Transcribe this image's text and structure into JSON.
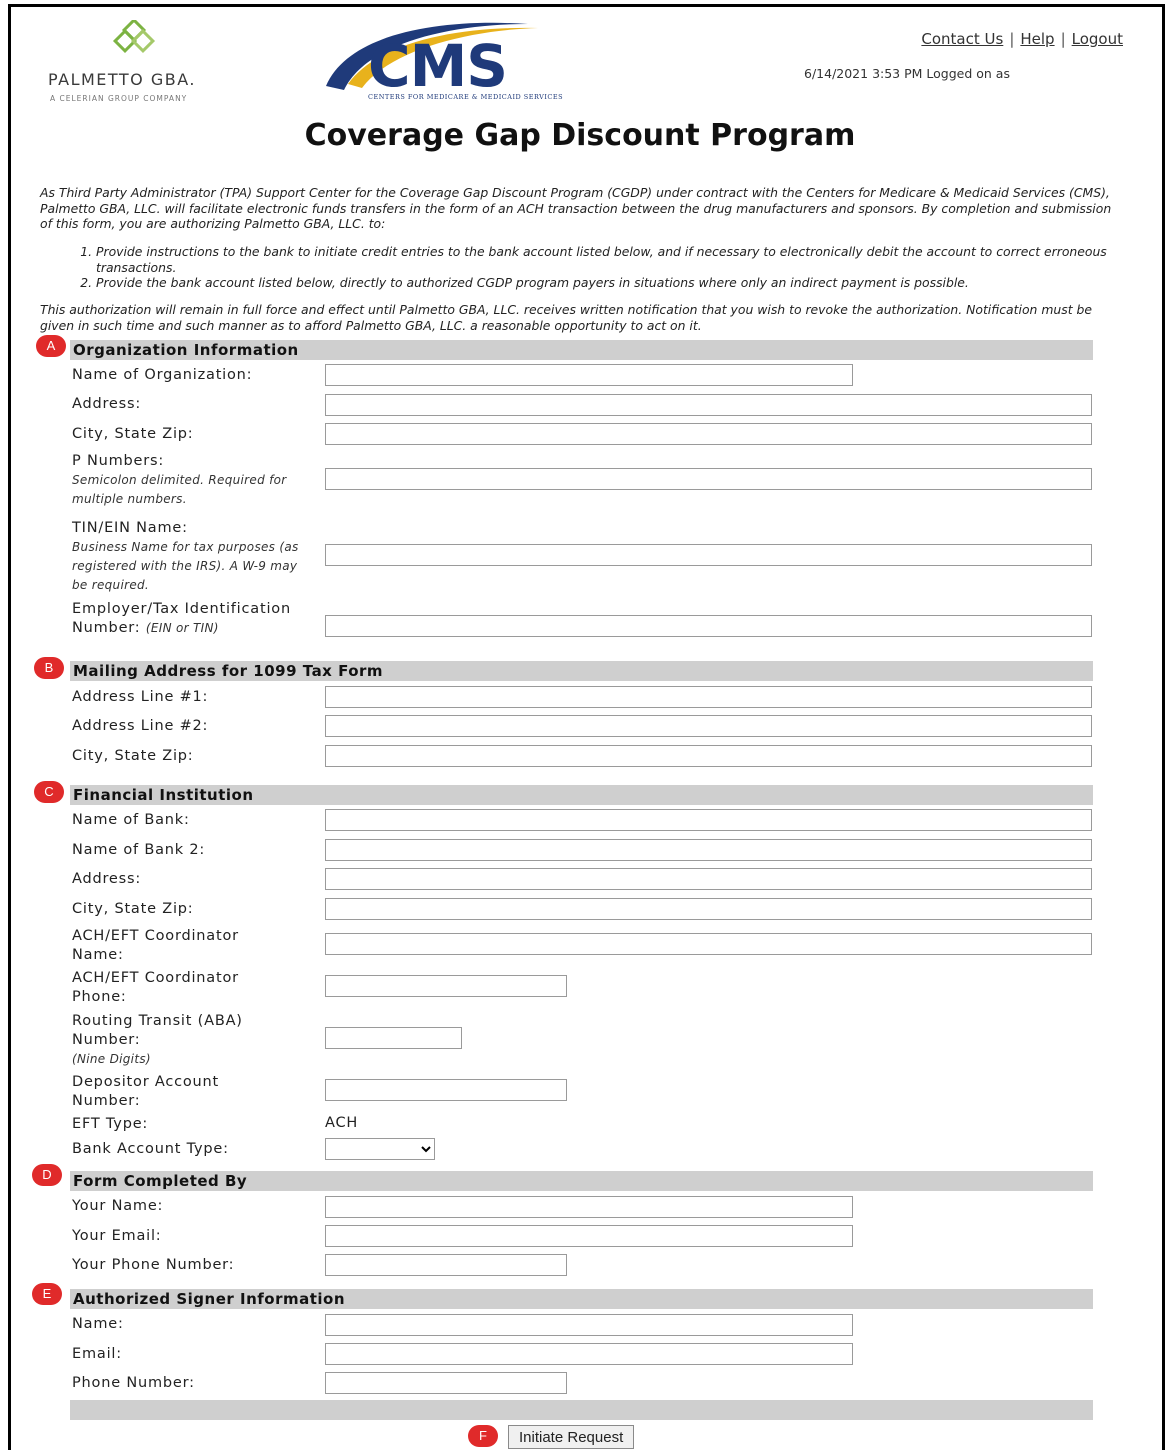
{
  "header": {
    "org_logo_name": "PALMETTO GBA.",
    "org_logo_sub": "A CELERIAN GROUP COMPANY",
    "cms_logo_word": "CMS",
    "cms_logo_sub": "CENTERS FOR MEDICARE & MEDICAID SERVICES",
    "links": {
      "contact": "Contact Us",
      "help": "Help",
      "logout": "Logout",
      "separator": "|"
    },
    "logged_on": "6/14/2021 3:53 PM  Logged on as",
    "colors": {
      "cms_blue": "#1f3a7a",
      "cms_swoosh": "#e8b21c",
      "pgba_green": "#7cb342"
    }
  },
  "title": "Coverage Gap Discount Program",
  "intro": {
    "para1": "As Third Party Administrator (TPA) Support Center for the Coverage Gap Discount Program (CGDP) under contract with the Centers for Medicare & Medicaid Services (CMS), Palmetto GBA, LLC. will facilitate electronic funds transfers in the form of an ACH transaction between the drug manufacturers and sponsors. By completion and submission of this form, you are authorizing Palmetto GBA, LLC. to:",
    "items": [
      "Provide instructions to the bank to initiate credit entries to the bank account listed below, and if necessary to electronically debit the account to correct erroneous transactions.",
      "Provide the bank account listed below, directly to authorized CGDP program payers in situations where only an indirect payment is possible."
    ],
    "para2": "This authorization will remain in full force and effect until Palmetto GBA, LLC. receives written notification that you wish to revoke the authorization. Notification must be given in such time and such manner as to afford Palmetto GBA, LLC. a reasonable opportunity to act on it."
  },
  "badge_color": "#e02a2a",
  "sections": {
    "org": {
      "badge": "A",
      "title": "Organization Information",
      "name": "Name of Organization:",
      "address": "Address:",
      "city": "City, State Zip:",
      "pnum": "P Numbers:",
      "pnum_hint": "Semicolon delimited. Required for multiple numbers.",
      "tin_name": "TIN/EIN Name:",
      "tin_hint": "Business Name for tax purposes (as registered with the IRS). A W-9 may be required.",
      "ein": "Employer/Tax Identification Number:",
      "ein_hint": "(EIN or TIN)"
    },
    "mail": {
      "badge": "B",
      "title": "Mailing Address for 1099 Tax Form",
      "line1": "Address Line #1:",
      "line2": "Address Line #2:",
      "city": "City, State Zip:"
    },
    "bank": {
      "badge": "C",
      "title": "Financial Institution",
      "name": "Name of Bank:",
      "name2": "Name of Bank 2:",
      "address": "Address:",
      "city": "City, State Zip:",
      "coord_name": "ACH/EFT Coordinator Name:",
      "coord_phone": "ACH/EFT Coordinator Phone:",
      "routing": "Routing Transit (ABA) Number:",
      "routing_hint": "(Nine Digits)",
      "account": "Depositor Account Number:",
      "eft_type": "EFT Type:",
      "eft_value": "ACH",
      "acct_type": "Bank Account Type:",
      "acct_type_selected": ""
    },
    "completed": {
      "badge": "D",
      "title": "Form Completed By",
      "name": "Your Name:",
      "email": "Your Email:",
      "phone": "Your Phone Number:"
    },
    "signer": {
      "badge": "E",
      "title": "Authorized Signer Information",
      "name": "Name:",
      "email": "Email:",
      "phone": "Phone Number:"
    }
  },
  "submit": {
    "badge": "F",
    "label": "Initiate Request"
  }
}
